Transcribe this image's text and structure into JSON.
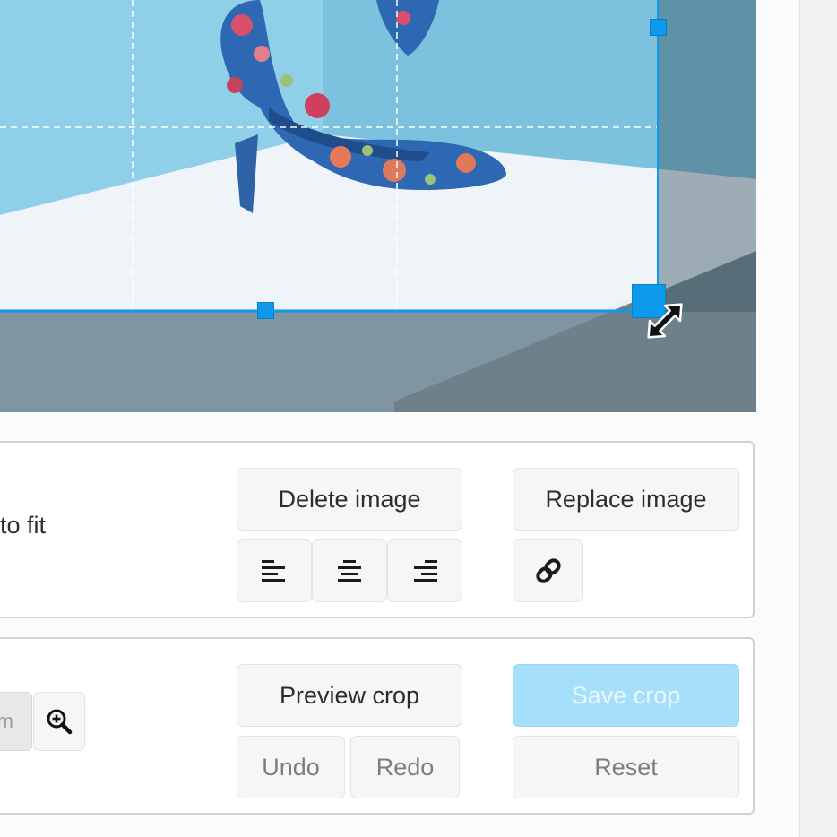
{
  "image_editor": {
    "alignment": {
      "label_partial": "to fit",
      "delete_label": "Delete image",
      "replace_label": "Replace image",
      "align_left_icon": "align-left-icon",
      "align_center_icon": "align-center-icon",
      "align_right_icon": "align-right-icon",
      "link_icon": "link-icon"
    },
    "crop": {
      "zoom_field_partial": "m",
      "zoom_in_icon": "zoom-in-icon",
      "preview_label": "Preview crop",
      "save_label": "Save crop",
      "undo_label": "Undo",
      "redo_label": "Redo",
      "reset_label": "Reset"
    },
    "canvas": {
      "cursor_icon": "resize-diagonal-cursor-icon",
      "accent_color": "#0d99ec",
      "save_disabled_color": "#a5dff9"
    }
  }
}
